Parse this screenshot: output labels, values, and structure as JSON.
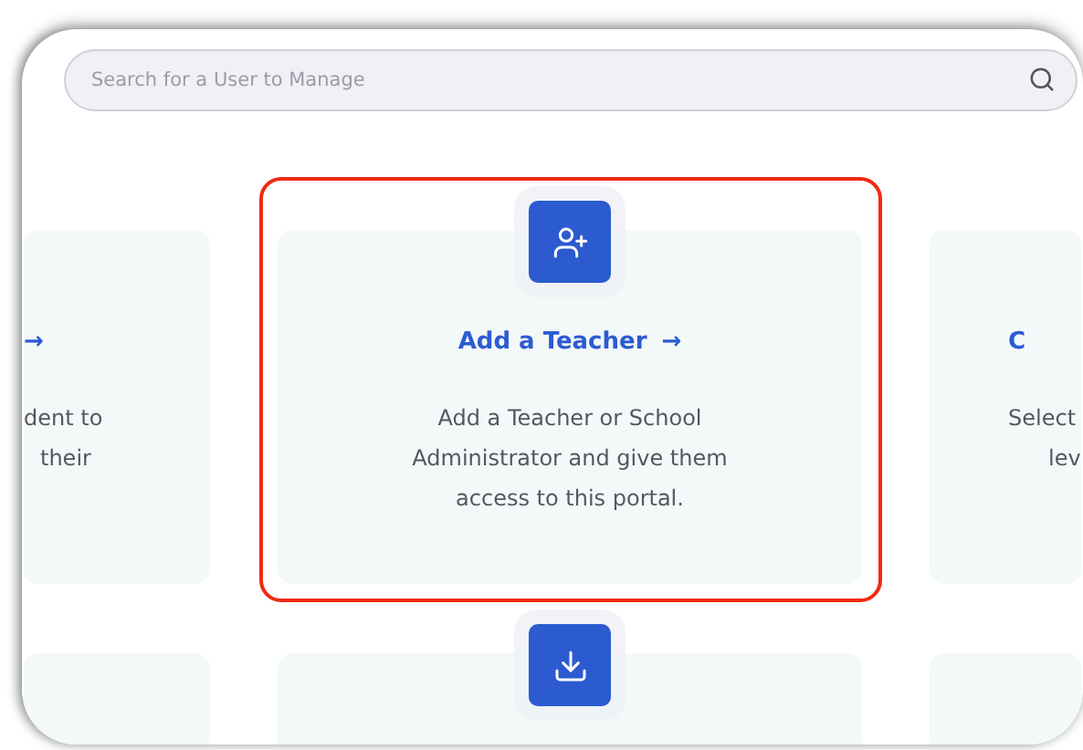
{
  "search": {
    "placeholder": "Search for a User to Manage"
  },
  "rows": [
    {
      "cards": [
        {
          "arrow": "→",
          "lines": [
            "dent to",
            "their"
          ],
          "highlighted": false
        },
        {
          "button": true,
          "title": "Add a Teacher",
          "arrow": "→",
          "lines": [
            "Add a Teacher or School",
            "Administrator and give them",
            "access to this portal."
          ],
          "highlighted": true
        },
        {
          "title": "C",
          "lines": [
            "Select",
            "lev"
          ],
          "highlighted": false
        }
      ]
    },
    {
      "cards": [
        {
          "highlighted": false
        },
        {
          "button": true,
          "highlighted": false
        },
        {
          "highlighted": false
        }
      ]
    }
  ]
}
